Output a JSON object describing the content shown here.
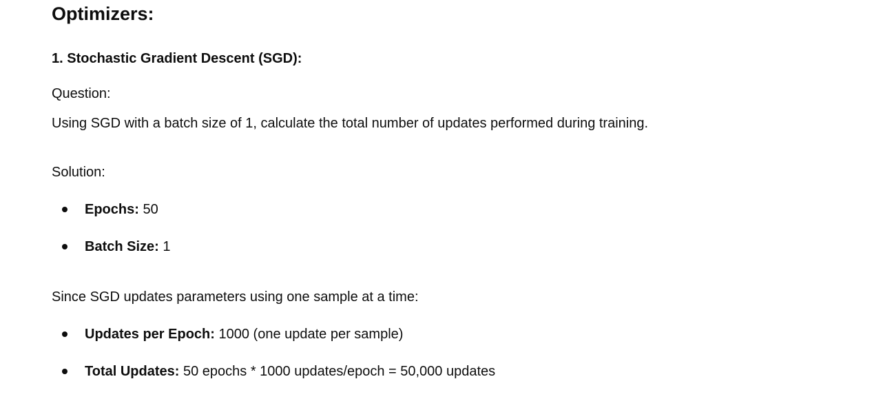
{
  "heading": "Optimizers:",
  "section": {
    "title": "1. Stochastic Gradient Descent (SGD):",
    "question_label": "Question:",
    "question_text": "Using SGD with a batch size of 1, calculate the total number of updates performed during training.",
    "solution_label": "Solution:",
    "given": [
      {
        "label": "Epochs:",
        "value": "50"
      },
      {
        "label": "Batch Size:",
        "value": "1"
      }
    ],
    "explanation": "Since SGD updates parameters using one sample at a time:",
    "results": [
      {
        "label": "Updates per Epoch:",
        "value": "1000 (one update per sample)"
      },
      {
        "label": "Total Updates:",
        "value": "50 epochs * 1000 updates/epoch = 50,000 updates"
      }
    ]
  }
}
